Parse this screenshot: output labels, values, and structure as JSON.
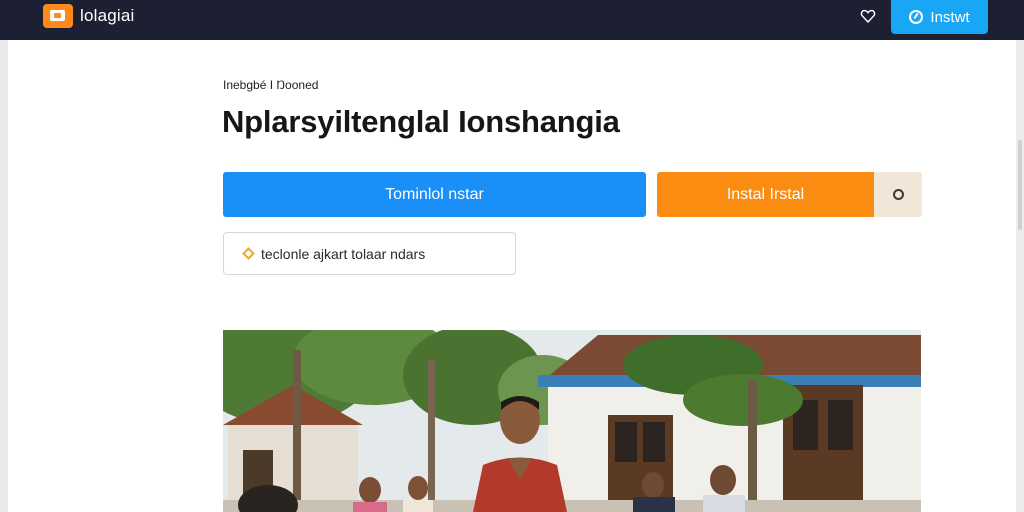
{
  "navbar": {
    "logo_text": "lolagiai",
    "install_label": "Instwt"
  },
  "breadcrumb": "Inebgbé I Ŋooned",
  "page_title": "Nplarsyiltenglal Ionshangia",
  "actions": {
    "primary_label": "Tominlol nstar",
    "secondary_label": "Instal Irstal"
  },
  "info_box": {
    "text": "teclonle ajkart tolaar ndars"
  },
  "photo_sign_text": "...",
  "colors": {
    "navbar": "#1d1f33",
    "accent_blue": "#1a8ff7",
    "accent_orange": "#fb8c12",
    "install_blue": "#19a7f5"
  },
  "icons": [
    "logo-icon",
    "heart-icon",
    "install-icon",
    "circle-icon",
    "diamond-icon"
  ]
}
